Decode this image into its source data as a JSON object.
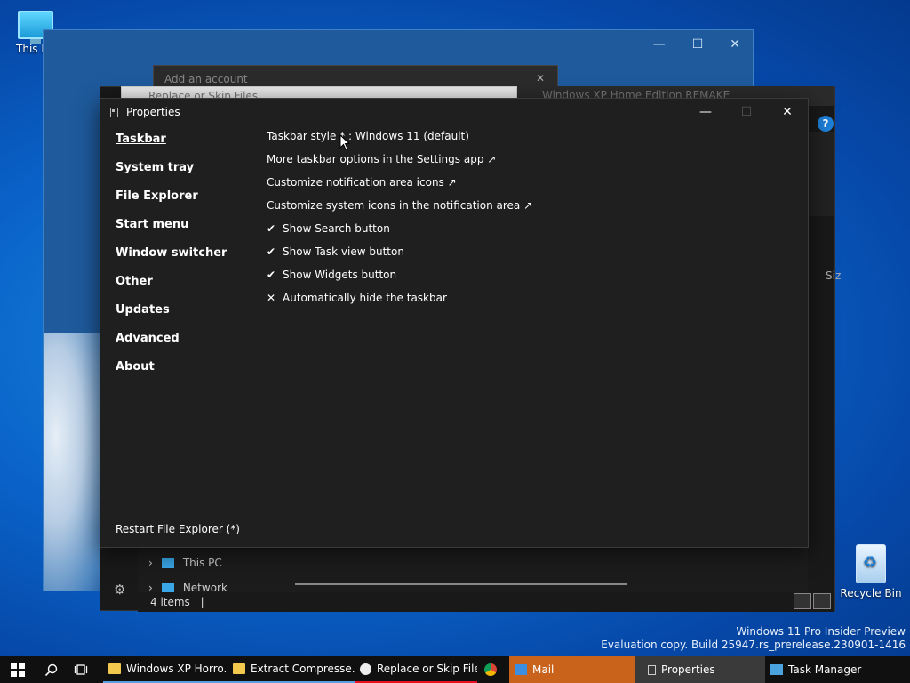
{
  "desktop": {
    "this_pc_label": "This PC",
    "recycle_bin_label": "Recycle Bin",
    "watermark_line1": "Windows 11 Pro Insider Preview",
    "watermark_line2": "Evaluation copy. Build 25947.rs_prerelease.230901-1416"
  },
  "background_windows": {
    "account_dialog_title": "Add an account",
    "replace_window_title": "Replace or Skip Files",
    "xp_window_title": "Windows XP Home Edition REMAKE",
    "help_label": "?",
    "size_column_label": "Siz",
    "tree_this_pc": "This PC",
    "tree_network": "Network",
    "status_items": "4 items"
  },
  "properties": {
    "title": "Properties",
    "nav": [
      {
        "label": "Taskbar",
        "active": true
      },
      {
        "label": "System tray"
      },
      {
        "label": "File Explorer"
      },
      {
        "label": "Start menu"
      },
      {
        "label": "Window switcher"
      },
      {
        "label": "Other"
      },
      {
        "label": "Updates"
      },
      {
        "label": "Advanced"
      },
      {
        "label": "About"
      }
    ],
    "options": [
      {
        "mark": "",
        "label": "Taskbar style * : Windows 11 (default)"
      },
      {
        "mark": "",
        "label": "More taskbar options in the Settings app ↗"
      },
      {
        "mark": "",
        "label": "Customize notification area icons ↗"
      },
      {
        "mark": "",
        "label": "Customize system icons in the notification area ↗"
      },
      {
        "mark": "✔",
        "label": "Show Search button"
      },
      {
        "mark": "✔",
        "label": "Show Task view button"
      },
      {
        "mark": "✔",
        "label": "Show Widgets button"
      },
      {
        "mark": "✕",
        "label": "Automatically hide the taskbar"
      }
    ],
    "restart_link": "Restart File Explorer (*)"
  },
  "taskbar": {
    "tasks": [
      {
        "label": "Windows XP Horro...",
        "icon": "folder-icon"
      },
      {
        "label": "Extract Compresse...",
        "icon": "folder-icon"
      },
      {
        "label": "Replace or Skip Files",
        "icon": "clock-icon"
      },
      {
        "label": "",
        "icon": "chrome-icon"
      },
      {
        "label": "Mail",
        "icon": "mail-icon"
      },
      {
        "label": "Properties",
        "icon": "properties-icon"
      },
      {
        "label": "Task Manager",
        "icon": "task-manager-icon"
      }
    ],
    "colors": {
      "mail_bg": "#c9631c",
      "properties_bg": "#3a3a3a",
      "replace_accent": "#e81123",
      "bar": "#101010"
    }
  }
}
